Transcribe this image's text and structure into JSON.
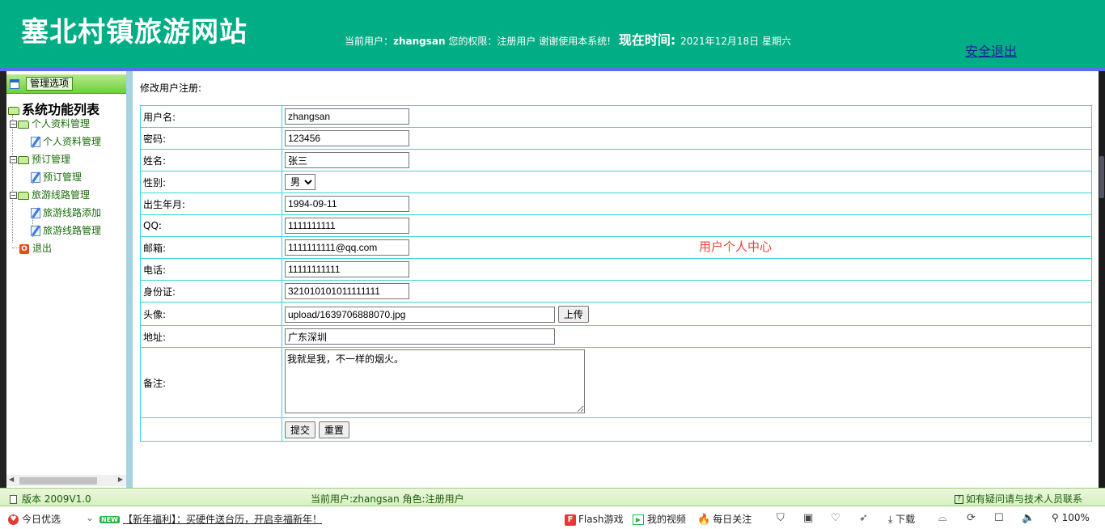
{
  "header": {
    "site_title": "塞北村镇旅游网站",
    "current_user_label": "当前用户：",
    "username": "zhangsan",
    "rights_label": " 您的权限：注册用户 谢谢使用本系统!",
    "now_time_label": "现在时间:",
    "date": "2021年12月18日 星期六",
    "logout": "安全退出"
  },
  "sidebar": {
    "mgmt_button": "管理选项",
    "root": "系统功能列表",
    "groups": [
      {
        "label": "个人资料管理",
        "items": [
          "个人资料管理"
        ]
      },
      {
        "label": "预订管理",
        "items": [
          "预订管理"
        ]
      },
      {
        "label": "旅游线路管理",
        "items": [
          "旅游线路添加",
          "旅游线路管理"
        ]
      }
    ],
    "exit": "退出"
  },
  "main": {
    "breadcrumb": "修改用户注册:",
    "center_title": "用户个人中心",
    "fields": {
      "username": {
        "label": "用户名:",
        "value": "zhangsan"
      },
      "password": {
        "label": "密码:",
        "value": "123456"
      },
      "name": {
        "label": "姓名:",
        "value": "张三"
      },
      "gender": {
        "label": "性别:",
        "value": "男"
      },
      "birth": {
        "label": "出生年月:",
        "value": "1994-09-11"
      },
      "qq": {
        "label": "QQ:",
        "value": "1111111111"
      },
      "email": {
        "label": "邮箱:",
        "value": "1111111111@qq.com"
      },
      "phone": {
        "label": "电话:",
        "value": "11111111111"
      },
      "idcard": {
        "label": "身份证:",
        "value": "321010101011111111"
      },
      "avatar": {
        "label": "头像:",
        "value": "upload/1639706888070.jpg"
      },
      "address": {
        "label": "地址:",
        "value": "广东深圳"
      },
      "remark": {
        "label": "备注:",
        "value": "我就是我，不一样的烟火。"
      }
    },
    "upload_button": "上传",
    "submit_button": "提交",
    "reset_button": "重置"
  },
  "footer": {
    "version": "版本 2009V1.0",
    "role_line": "当前用户:zhangsan  角色:注册用户",
    "help": "如有疑问请与技术人员联系"
  },
  "browser_bar": {
    "today": "今日优选",
    "promo": "【新年福利】：买硬件送台历，开启幸福新年！",
    "flash": "Flash游戏",
    "videos": "我的视频",
    "daily": "每日关注",
    "download": "下载",
    "zoom": "100%"
  }
}
